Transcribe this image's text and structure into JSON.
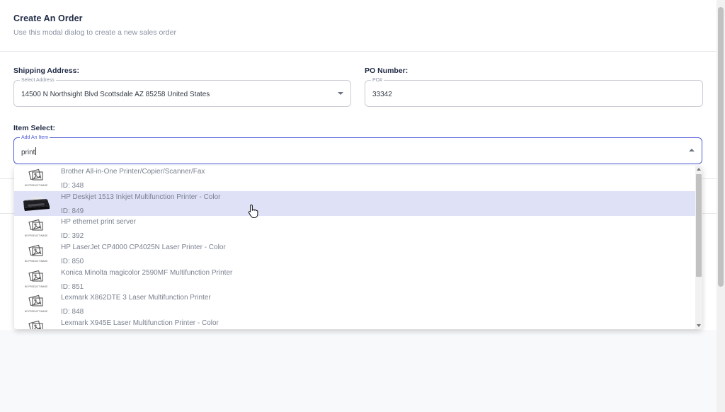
{
  "modal": {
    "title": "Create An Order",
    "subtitle": "Use this modal dialog to create a new sales order"
  },
  "shipping": {
    "label": "Shipping Address:",
    "legend": "Select Address",
    "value": "14500 N Northsight Blvd Scottsdale AZ 85258 United States"
  },
  "po": {
    "label": "PO Number:",
    "legend": "PO#",
    "value": "33342"
  },
  "item_select": {
    "label": "Item Select:",
    "legend": "Add An Item",
    "value": "print"
  },
  "placeholder_image_text": "NO PRODUCT IMAGE",
  "results": [
    {
      "name": "Brother All-in-One Printer/Copier/Scanner/Fax",
      "id": "ID: 348",
      "image": "placeholder"
    },
    {
      "name": "HP Deskjet 1513 Inkjet Multifunction Printer - Color",
      "id": "ID: 849",
      "image": "printer"
    },
    {
      "name": "HP ethernet print server",
      "id": "ID: 392",
      "image": "placeholder"
    },
    {
      "name": "HP LaserJet CP4000 CP4025N Laser Printer - Color",
      "id": "ID: 850",
      "image": "placeholder"
    },
    {
      "name": "Konica Minolta magicolor 2590MF Multifunction Printer",
      "id": "ID: 851",
      "image": "placeholder"
    },
    {
      "name": "Lexmark X862DTE 3 Laser Multifunction Printer",
      "id": "ID: 848",
      "image": "placeholder"
    },
    {
      "name": "Lexmark X945E Laser Multifunction Printer - Color",
      "id": "",
      "image": "placeholder"
    }
  ],
  "selected_index": 1,
  "icons": {
    "dropdown_caret": "chevron-down-icon",
    "placeholder": "no-image-icon",
    "cursor": "hand-pointer-icon"
  }
}
